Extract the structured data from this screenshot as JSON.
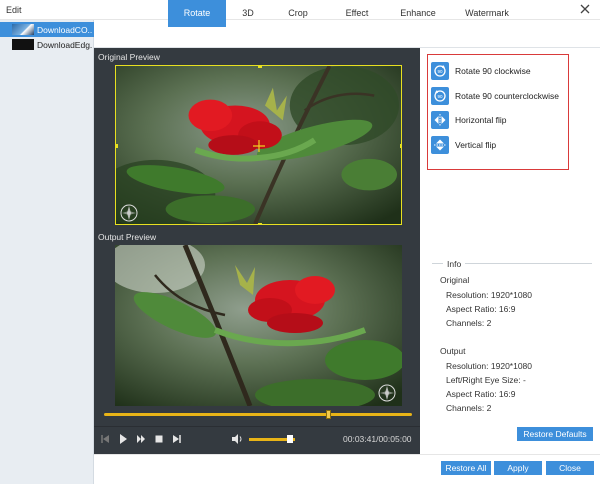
{
  "window": {
    "title": "Edit"
  },
  "files": [
    {
      "name": "DownloadCO...",
      "selected": true
    },
    {
      "name": "DownloadEdg...",
      "selected": false
    }
  ],
  "tabs": [
    "Rotate",
    "3D",
    "Crop",
    "Effect",
    "Enhance",
    "Watermark"
  ],
  "active_tab": "Rotate",
  "preview": {
    "original_label": "Original Preview",
    "output_label": "Output Preview",
    "progress": 0.73,
    "volume": 0.9,
    "time": "00:03:41/00:05:00"
  },
  "rotate_options": [
    {
      "label": "Rotate 90 clockwise",
      "icon": "rotate-clockwise-icon"
    },
    {
      "label": "Rotate 90 counterclockwise",
      "icon": "rotate-counterclockwise-icon"
    },
    {
      "label": "Horizontal flip",
      "icon": "horizontal-flip-icon"
    },
    {
      "label": "Vertical flip",
      "icon": "vertical-flip-icon"
    }
  ],
  "info": {
    "legend": "Info",
    "original_heading": "Original",
    "original": {
      "resolution": "Resolution: 1920*1080",
      "aspect": "Aspect Ratio: 16:9",
      "channels": "Channels: 2"
    },
    "output_heading": "Output",
    "output": {
      "resolution": "Resolution: 1920*1080",
      "eye": "Left/Right Eye Size: -",
      "aspect": "Aspect Ratio: 16:9",
      "channels": "Channels: 2"
    }
  },
  "buttons": {
    "restore_defaults": "Restore Defaults",
    "restore_all": "Restore All",
    "apply": "Apply",
    "close": "Close"
  },
  "colors": {
    "accent": "#3d8fdb",
    "crop_frame": "#e8e020",
    "timeline": "#e8b417",
    "highlight_box": "#d93a3a",
    "preview_bg": "#343a40"
  }
}
